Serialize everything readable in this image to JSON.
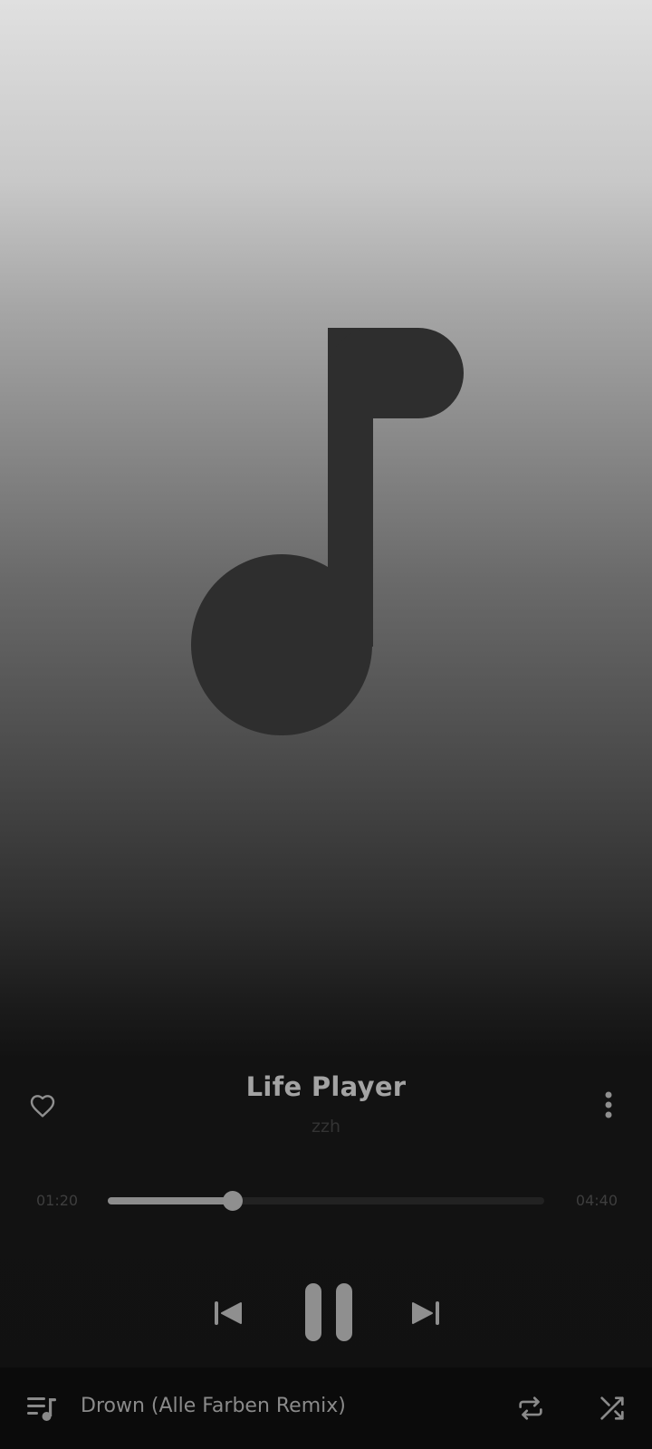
{
  "player": {
    "title": "Life Player",
    "artist": "zzh",
    "elapsed": "01:20",
    "duration": "04:40",
    "progress_fraction": 0.2857,
    "state": "playing"
  },
  "icons": {
    "artwork": "music-note-icon",
    "like": "heart-outline-icon",
    "more": "more-vertical-icon",
    "previous": "skip-previous-icon",
    "pause": "pause-icon",
    "next": "skip-next-icon",
    "queue": "queue-music-icon",
    "repeat": "repeat-icon",
    "shuffle": "shuffle-icon"
  },
  "bottom_bar": {
    "now_playing": "Drown (Alle Farben Remix)"
  },
  "colors": {
    "artwork_note": "#2e2e2e",
    "title_text": "#a3a3a3",
    "artist_text": "#333333",
    "progress_fill": "#8c8c8c",
    "progress_track": "#222222",
    "control_icons": "#8f8f8f",
    "bottom_bar_bg": "#0b0b0b"
  }
}
